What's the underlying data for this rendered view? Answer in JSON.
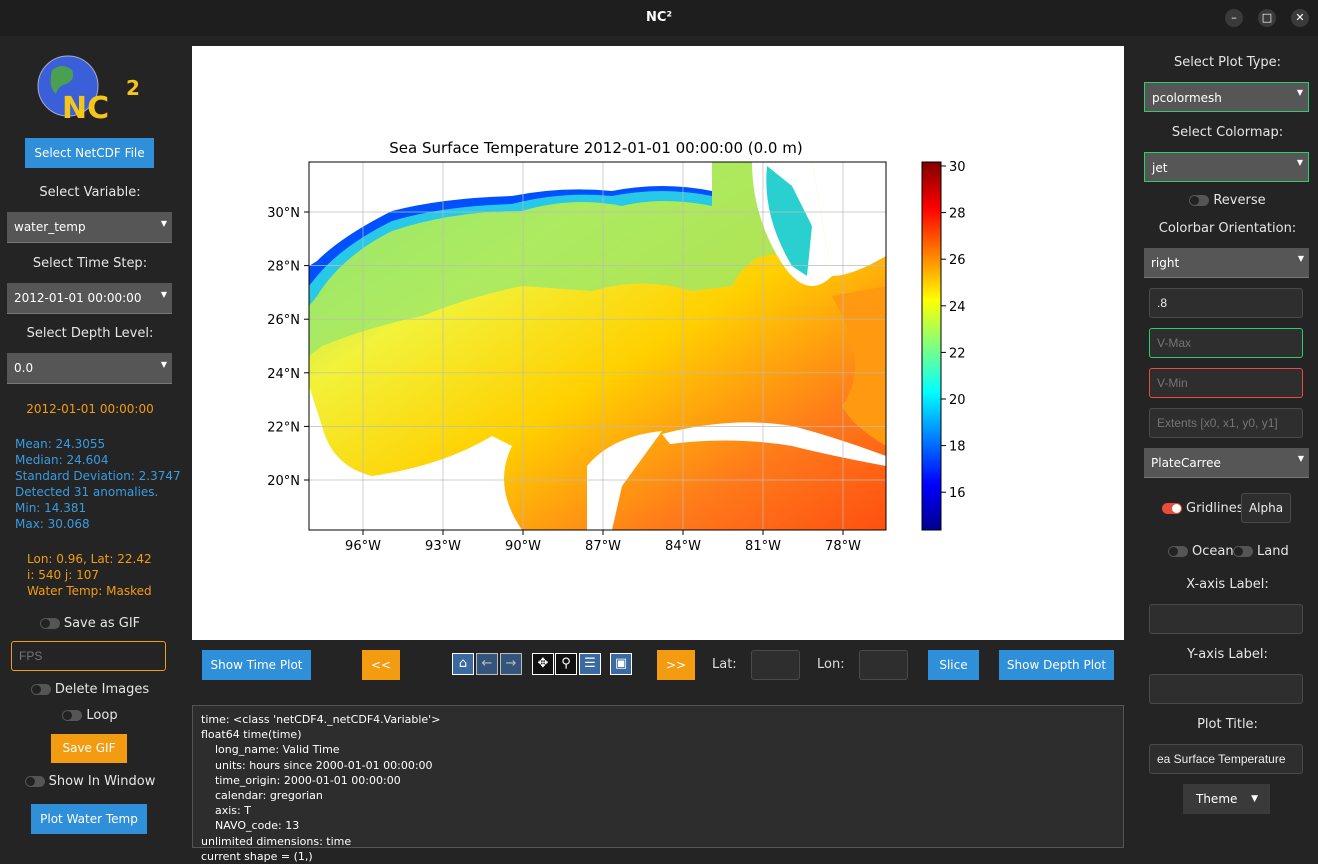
{
  "window": {
    "title": "NC²",
    "minimize": "–",
    "maximize": "□",
    "close": "✕"
  },
  "left": {
    "logo_text": "NC²",
    "select_file": "Select NetCDF File",
    "select_variable_label": "Select Variable:",
    "variable": "water_temp",
    "select_time_label": "Select Time Step:",
    "time": "2012-01-01 00:00:00",
    "select_depth_label": "Select Depth Level:",
    "depth": "0.0",
    "current_time": "2012-01-01 00:00:00",
    "stats": {
      "mean": "Mean: 24.3055",
      "median": "Median: 24.604",
      "std": "Standard Deviation: 2.3747",
      "anomalies": "Detected 31 anomalies.",
      "min": "Min: 14.381",
      "max": "Max: 30.068"
    },
    "cursor": {
      "lonlat": "Lon: 0.96, Lat: 22.42",
      "ij": "i: 540 j: 107",
      "value": "Water Temp: Masked"
    },
    "save_gif_toggle": "Save as GIF",
    "save_gif_on": false,
    "fps_placeholder": "FPS",
    "delete_images": "Delete Images",
    "delete_images_on": false,
    "loop": "Loop",
    "loop_on": false,
    "save_gif_button": "Save GIF",
    "show_in_window": "Show In Window",
    "show_in_window_on": false,
    "plot_button": "Plot Water Temp"
  },
  "plot": {
    "title": "Sea Surface Temperature 2012-01-01 00:00:00 (0.0 m)",
    "lon_ticks": [
      "96°W",
      "93°W",
      "90°W",
      "87°W",
      "84°W",
      "81°W",
      "78°W"
    ],
    "lat_ticks": [
      "30°N",
      "28°N",
      "26°N",
      "24°N",
      "22°N",
      "20°N"
    ],
    "colorbar_ticks": [
      "30",
      "28",
      "26",
      "24",
      "22",
      "20",
      "18",
      "16"
    ],
    "colormap": "jet"
  },
  "controls": {
    "show_time_plot": "Show Time Plot",
    "prev": "<<",
    "next": ">>",
    "toolbar": [
      "home-icon",
      "back-icon",
      "forward-icon",
      "pan-icon",
      "zoom-icon",
      "configure-icon",
      "save-icon"
    ],
    "lat_label": "Lat:",
    "lon_label": "Lon:",
    "lat_value": "",
    "lon_value": "",
    "slice": "Slice",
    "show_depth_plot": "Show Depth Plot"
  },
  "console": "time: <class 'netCDF4._netCDF4.Variable'>\nfloat64 time(time)\n    long_name: Valid Time\n    units: hours since 2000-01-01 00:00:00\n    time_origin: 2000-01-01 00:00:00\n    calendar: gregorian\n    axis: T\n    NAVO_code: 13\nunlimited dimensions: time\ncurrent shape = (1,)",
  "right": {
    "plot_type_label": "Select Plot Type:",
    "plot_type": "pcolormesh",
    "colormap_label": "Select Colormap:",
    "colormap": "jet",
    "reverse": "Reverse",
    "reverse_on": false,
    "orientation_label": "Colorbar Orientation:",
    "orientation": "right",
    "alpha_value": ".8",
    "vmax_placeholder": "V-Max",
    "vmin_placeholder": "V-Min",
    "extents_placeholder": "Extents [x0, x1, y0, y1]",
    "projection": "PlateCarree",
    "gridlines": "Gridlines",
    "gridlines_on": true,
    "alpha_button": "Alpha",
    "ocean": "Ocean",
    "ocean_on": false,
    "land": "Land",
    "land_on": false,
    "xlabel_label": "X-axis Label:",
    "xlabel_value": "",
    "ylabel_label": "Y-axis Label:",
    "ylabel_value": "",
    "title_label": "Plot Title:",
    "title_value": "ea Surface Temperature",
    "theme": "Theme"
  },
  "colors": {
    "accent_blue": "#2f8fd8",
    "accent_orange": "#f39c12",
    "stats_blue": "#3a9be0",
    "vmax_border": "#2ecc71",
    "vmin_border": "#e74c3c"
  }
}
